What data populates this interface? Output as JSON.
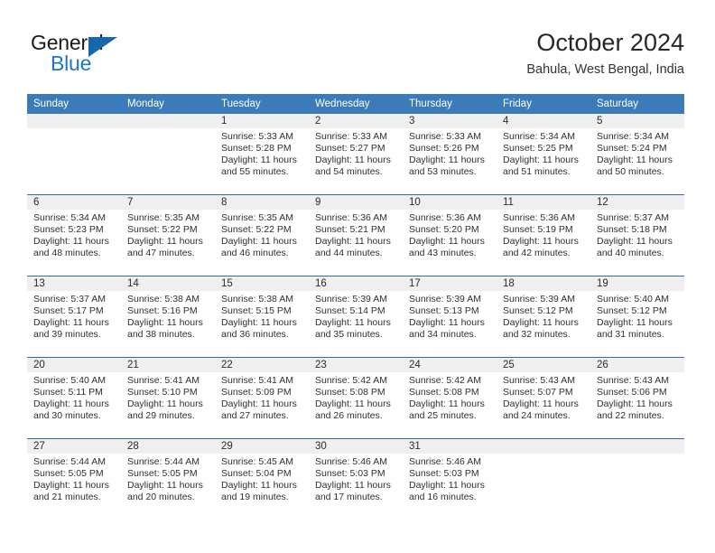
{
  "logo": {
    "word1": "General",
    "word2": "Blue",
    "triangle_color": "#1767ab",
    "blue_color": "#1f77c4"
  },
  "header": {
    "title": "October 2024",
    "location": "Bahula, West Bengal, India"
  },
  "theme": {
    "header_row_bg": "#3b7cb8",
    "row_divider": "#2f6da8",
    "daynum_band_bg": "#efefef",
    "page_bg": "#ffffff"
  },
  "weekdays": [
    "Sunday",
    "Monday",
    "Tuesday",
    "Wednesday",
    "Thursday",
    "Friday",
    "Saturday"
  ],
  "labels": {
    "sunrise": "Sunrise:",
    "sunset": "Sunset:",
    "daylight": "Daylight:"
  },
  "weeks": [
    [
      {
        "day": "",
        "sunrise": "",
        "sunset": "",
        "daylight1": "",
        "daylight2": ""
      },
      {
        "day": "",
        "sunrise": "",
        "sunset": "",
        "daylight1": "",
        "daylight2": ""
      },
      {
        "day": "1",
        "sunrise": "Sunrise: 5:33 AM",
        "sunset": "Sunset: 5:28 PM",
        "daylight1": "Daylight: 11 hours",
        "daylight2": "and 55 minutes."
      },
      {
        "day": "2",
        "sunrise": "Sunrise: 5:33 AM",
        "sunset": "Sunset: 5:27 PM",
        "daylight1": "Daylight: 11 hours",
        "daylight2": "and 54 minutes."
      },
      {
        "day": "3",
        "sunrise": "Sunrise: 5:33 AM",
        "sunset": "Sunset: 5:26 PM",
        "daylight1": "Daylight: 11 hours",
        "daylight2": "and 53 minutes."
      },
      {
        "day": "4",
        "sunrise": "Sunrise: 5:34 AM",
        "sunset": "Sunset: 5:25 PM",
        "daylight1": "Daylight: 11 hours",
        "daylight2": "and 51 minutes."
      },
      {
        "day": "5",
        "sunrise": "Sunrise: 5:34 AM",
        "sunset": "Sunset: 5:24 PM",
        "daylight1": "Daylight: 11 hours",
        "daylight2": "and 50 minutes."
      }
    ],
    [
      {
        "day": "6",
        "sunrise": "Sunrise: 5:34 AM",
        "sunset": "Sunset: 5:23 PM",
        "daylight1": "Daylight: 11 hours",
        "daylight2": "and 48 minutes."
      },
      {
        "day": "7",
        "sunrise": "Sunrise: 5:35 AM",
        "sunset": "Sunset: 5:22 PM",
        "daylight1": "Daylight: 11 hours",
        "daylight2": "and 47 minutes."
      },
      {
        "day": "8",
        "sunrise": "Sunrise: 5:35 AM",
        "sunset": "Sunset: 5:22 PM",
        "daylight1": "Daylight: 11 hours",
        "daylight2": "and 46 minutes."
      },
      {
        "day": "9",
        "sunrise": "Sunrise: 5:36 AM",
        "sunset": "Sunset: 5:21 PM",
        "daylight1": "Daylight: 11 hours",
        "daylight2": "and 44 minutes."
      },
      {
        "day": "10",
        "sunrise": "Sunrise: 5:36 AM",
        "sunset": "Sunset: 5:20 PM",
        "daylight1": "Daylight: 11 hours",
        "daylight2": "and 43 minutes."
      },
      {
        "day": "11",
        "sunrise": "Sunrise: 5:36 AM",
        "sunset": "Sunset: 5:19 PM",
        "daylight1": "Daylight: 11 hours",
        "daylight2": "and 42 minutes."
      },
      {
        "day": "12",
        "sunrise": "Sunrise: 5:37 AM",
        "sunset": "Sunset: 5:18 PM",
        "daylight1": "Daylight: 11 hours",
        "daylight2": "and 40 minutes."
      }
    ],
    [
      {
        "day": "13",
        "sunrise": "Sunrise: 5:37 AM",
        "sunset": "Sunset: 5:17 PM",
        "daylight1": "Daylight: 11 hours",
        "daylight2": "and 39 minutes."
      },
      {
        "day": "14",
        "sunrise": "Sunrise: 5:38 AM",
        "sunset": "Sunset: 5:16 PM",
        "daylight1": "Daylight: 11 hours",
        "daylight2": "and 38 minutes."
      },
      {
        "day": "15",
        "sunrise": "Sunrise: 5:38 AM",
        "sunset": "Sunset: 5:15 PM",
        "daylight1": "Daylight: 11 hours",
        "daylight2": "and 36 minutes."
      },
      {
        "day": "16",
        "sunrise": "Sunrise: 5:39 AM",
        "sunset": "Sunset: 5:14 PM",
        "daylight1": "Daylight: 11 hours",
        "daylight2": "and 35 minutes."
      },
      {
        "day": "17",
        "sunrise": "Sunrise: 5:39 AM",
        "sunset": "Sunset: 5:13 PM",
        "daylight1": "Daylight: 11 hours",
        "daylight2": "and 34 minutes."
      },
      {
        "day": "18",
        "sunrise": "Sunrise: 5:39 AM",
        "sunset": "Sunset: 5:12 PM",
        "daylight1": "Daylight: 11 hours",
        "daylight2": "and 32 minutes."
      },
      {
        "day": "19",
        "sunrise": "Sunrise: 5:40 AM",
        "sunset": "Sunset: 5:12 PM",
        "daylight1": "Daylight: 11 hours",
        "daylight2": "and 31 minutes."
      }
    ],
    [
      {
        "day": "20",
        "sunrise": "Sunrise: 5:40 AM",
        "sunset": "Sunset: 5:11 PM",
        "daylight1": "Daylight: 11 hours",
        "daylight2": "and 30 minutes."
      },
      {
        "day": "21",
        "sunrise": "Sunrise: 5:41 AM",
        "sunset": "Sunset: 5:10 PM",
        "daylight1": "Daylight: 11 hours",
        "daylight2": "and 29 minutes."
      },
      {
        "day": "22",
        "sunrise": "Sunrise: 5:41 AM",
        "sunset": "Sunset: 5:09 PM",
        "daylight1": "Daylight: 11 hours",
        "daylight2": "and 27 minutes."
      },
      {
        "day": "23",
        "sunrise": "Sunrise: 5:42 AM",
        "sunset": "Sunset: 5:08 PM",
        "daylight1": "Daylight: 11 hours",
        "daylight2": "and 26 minutes."
      },
      {
        "day": "24",
        "sunrise": "Sunrise: 5:42 AM",
        "sunset": "Sunset: 5:08 PM",
        "daylight1": "Daylight: 11 hours",
        "daylight2": "and 25 minutes."
      },
      {
        "day": "25",
        "sunrise": "Sunrise: 5:43 AM",
        "sunset": "Sunset: 5:07 PM",
        "daylight1": "Daylight: 11 hours",
        "daylight2": "and 24 minutes."
      },
      {
        "day": "26",
        "sunrise": "Sunrise: 5:43 AM",
        "sunset": "Sunset: 5:06 PM",
        "daylight1": "Daylight: 11 hours",
        "daylight2": "and 22 minutes."
      }
    ],
    [
      {
        "day": "27",
        "sunrise": "Sunrise: 5:44 AM",
        "sunset": "Sunset: 5:05 PM",
        "daylight1": "Daylight: 11 hours",
        "daylight2": "and 21 minutes."
      },
      {
        "day": "28",
        "sunrise": "Sunrise: 5:44 AM",
        "sunset": "Sunset: 5:05 PM",
        "daylight1": "Daylight: 11 hours",
        "daylight2": "and 20 minutes."
      },
      {
        "day": "29",
        "sunrise": "Sunrise: 5:45 AM",
        "sunset": "Sunset: 5:04 PM",
        "daylight1": "Daylight: 11 hours",
        "daylight2": "and 19 minutes."
      },
      {
        "day": "30",
        "sunrise": "Sunrise: 5:46 AM",
        "sunset": "Sunset: 5:03 PM",
        "daylight1": "Daylight: 11 hours",
        "daylight2": "and 17 minutes."
      },
      {
        "day": "31",
        "sunrise": "Sunrise: 5:46 AM",
        "sunset": "Sunset: 5:03 PM",
        "daylight1": "Daylight: 11 hours",
        "daylight2": "and 16 minutes."
      },
      {
        "day": "",
        "sunrise": "",
        "sunset": "",
        "daylight1": "",
        "daylight2": ""
      },
      {
        "day": "",
        "sunrise": "",
        "sunset": "",
        "daylight1": "",
        "daylight2": ""
      }
    ]
  ]
}
